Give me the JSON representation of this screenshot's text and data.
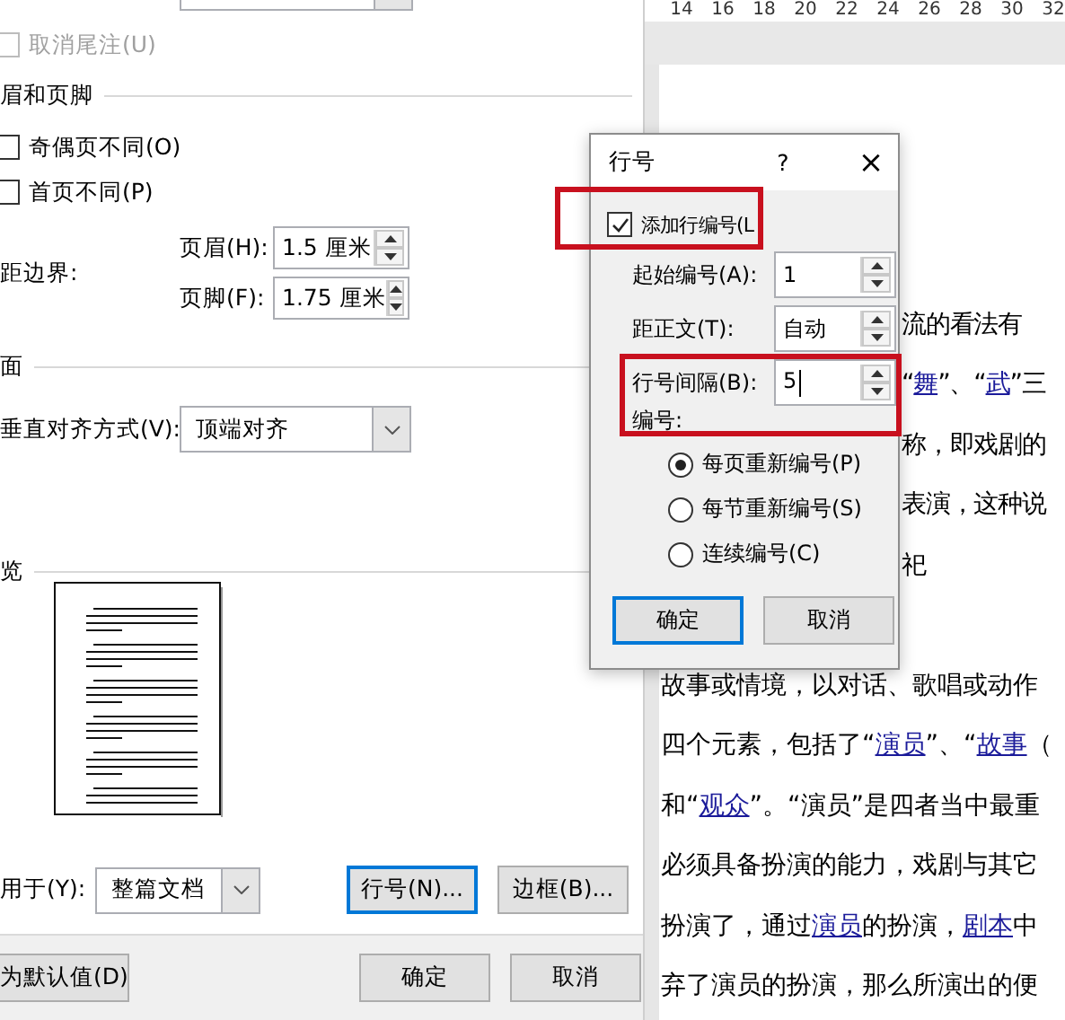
{
  "page_setup": {
    "disabled_checkbox": {
      "label": "取消尾注(U)",
      "checked": false,
      "disabled": true
    },
    "header_footer_section": "眉和页脚",
    "checkboxes": [
      {
        "label": "奇偶页不同(O)",
        "checked": false,
        "disabled": false
      },
      {
        "label": "首页不同(P)",
        "checked": false,
        "disabled": false
      }
    ],
    "from_edge_label": "距边界:",
    "spinners": [
      {
        "label": "页眉(H):",
        "value": "1.5 厘米"
      },
      {
        "label": "页脚(F):",
        "value": "1.75 厘米"
      }
    ],
    "page_section": "面",
    "vertical_alignment": {
      "label": "垂直对齐方式(V):",
      "value": "顶端对齐"
    },
    "preview_section": "览",
    "apply_to": {
      "label": "用于(Y):",
      "value": "整篇文档"
    },
    "buttons": [
      {
        "label": "行号(N)...",
        "focused": true
      },
      {
        "label": "边框(B)...",
        "focused": false
      }
    ],
    "footer_buttons": [
      {
        "label": "为默认值(D)",
        "focused": false
      },
      {
        "label": "确定",
        "focused": false
      },
      {
        "label": "取消",
        "focused": false
      }
    ]
  },
  "document": {
    "ruler": [
      "14",
      "16",
      "18",
      "20",
      "22",
      "24",
      "26",
      "28",
      "30",
      "32"
    ],
    "lines_beside_dialog": [
      [
        {
          "text": "流的看法有",
          "link": false
        }
      ],
      [
        {
          "text": "“",
          "link": false
        },
        {
          "text": "舞",
          "link": true
        },
        {
          "text": "”、“",
          "link": false
        },
        {
          "text": "武",
          "link": true
        },
        {
          "text": "”三",
          "link": false
        }
      ],
      [
        {
          "text": "称，即戏剧的",
          "link": false
        }
      ],
      [
        {
          "text": "表演，这种说",
          "link": false
        }
      ],
      [
        {
          "text": "祀",
          "link": false
        }
      ]
    ],
    "lines_below_dialog": [
      [
        {
          "text": "故事或情境，以对话、歌唱或动作",
          "link": false
        }
      ],
      [
        {
          "text": "四个元素，包括了“",
          "link": false
        },
        {
          "text": "演员",
          "link": true
        },
        {
          "text": "”、“",
          "link": false
        },
        {
          "text": "故事",
          "link": true
        },
        {
          "text": "（",
          "link": false
        }
      ],
      [
        {
          "text": "和“",
          "link": false
        },
        {
          "text": "观众",
          "link": true
        },
        {
          "text": "”。“演员”是四者当中最重",
          "link": false
        }
      ],
      [
        {
          "text": "必须具备扮演的能力，戏剧与其它",
          "link": false
        }
      ],
      [
        {
          "text": "扮演了，通过",
          "link": false
        },
        {
          "text": "演员",
          "link": true
        },
        {
          "text": "的扮演，",
          "link": false
        },
        {
          "text": "剧本",
          "link": true
        },
        {
          "text": "中",
          "link": false
        }
      ],
      [
        {
          "text": "弃了演员的扮演，那么所演出的便",
          "link": false
        }
      ]
    ]
  },
  "line_numbers_dialog": {
    "title": "行号",
    "help": "?",
    "close": "×",
    "add_checkbox": {
      "label": "添加行编号(L",
      "checked": true
    },
    "fields": [
      {
        "label": "起始编号(A):",
        "value": "1"
      },
      {
        "label": "距正文(T):",
        "value": "自动"
      },
      {
        "label": "行号间隔(B):",
        "value": "5"
      }
    ],
    "numbering_label": "编号:",
    "radios": [
      {
        "label": "每页重新编号(P)",
        "selected": true
      },
      {
        "label": "每节重新编号(S)",
        "selected": false
      },
      {
        "label": "连续编号(C)",
        "selected": false
      }
    ],
    "buttons": [
      {
        "label": "确定",
        "focused": true
      },
      {
        "label": "取消",
        "focused": false
      }
    ]
  }
}
